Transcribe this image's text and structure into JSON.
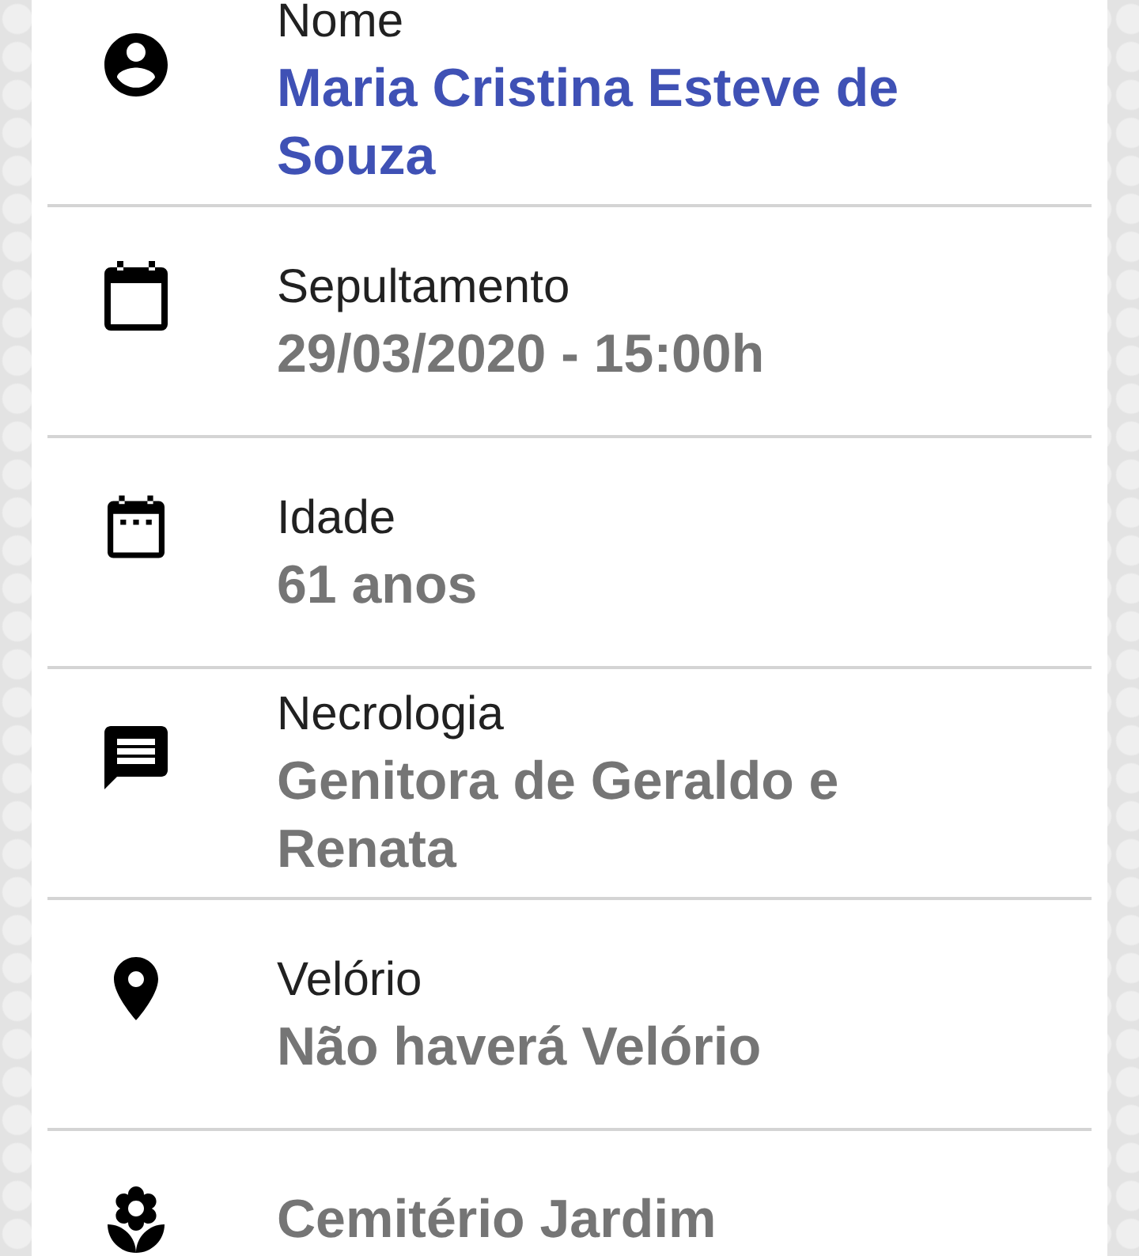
{
  "fields": [
    {
      "label": "Nome",
      "value": "Maria Cristina Esteve de Souza",
      "color": "#3f51b5"
    },
    {
      "label": "Sepultamento",
      "value": "29/03/2020 - 15:00h",
      "color": "#757575"
    },
    {
      "label": "Idade",
      "value": "61 anos",
      "color": "#757575"
    },
    {
      "label": "Necrologia",
      "value": "Genitora de Geraldo e Renata",
      "color": "#757575"
    },
    {
      "label": "Velório",
      "value": "Não haverá Velório",
      "color": "#757575"
    },
    {
      "value": "Cemitério Jardim",
      "color": "#757575"
    }
  ]
}
